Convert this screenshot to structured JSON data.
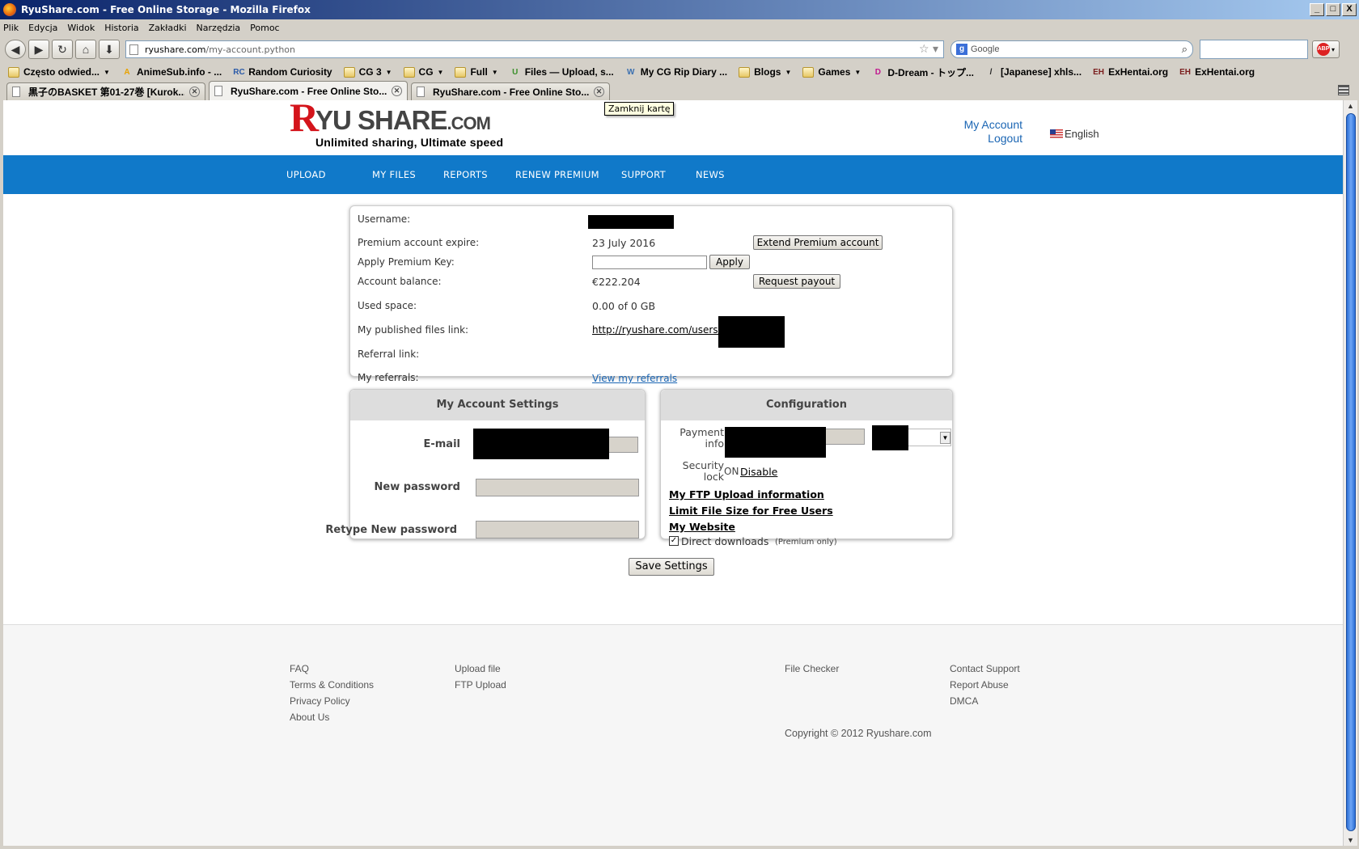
{
  "window": {
    "title": "RyuShare.com - Free Online Storage - Mozilla Firefox",
    "buttons": [
      "_",
      "□",
      "X"
    ]
  },
  "menu": [
    "Plik",
    "Edycja",
    "Widok",
    "Historia",
    "Zakładki",
    "Narzędzia",
    "Pomoc"
  ],
  "urlbar": {
    "host": "ryushare.com",
    "path": "/my-account.python"
  },
  "search": {
    "engine_icon": "g",
    "placeholder": "Google"
  },
  "bookmarks": [
    {
      "label": "Często odwied...",
      "icon": "gear-folder",
      "caret": true
    },
    {
      "label": "AnimeSub.info - ...",
      "icon": "A",
      "caret": false
    },
    {
      "label": "Random Curiosity",
      "icon": "RC",
      "caret": false
    },
    {
      "label": "CG 3",
      "icon": "folder",
      "caret": true
    },
    {
      "label": "CG",
      "icon": "folder",
      "caret": true
    },
    {
      "label": "Full",
      "icon": "folder",
      "caret": true
    },
    {
      "label": "Files — Upload, s...",
      "icon": "U",
      "caret": false
    },
    {
      "label": "My CG Rip Diary ...",
      "icon": "W",
      "caret": false
    },
    {
      "label": "Blogs",
      "icon": "folder",
      "caret": true
    },
    {
      "label": "Games",
      "icon": "folder",
      "caret": true
    },
    {
      "label": "D-Dream - トップ...",
      "icon": "D",
      "caret": false
    },
    {
      "label": "[Japanese] xhls...",
      "icon": "/",
      "caret": false
    },
    {
      "label": "ExHentai.org",
      "icon": "EH",
      "caret": false
    },
    {
      "label": "ExHentai.org",
      "icon": "EH",
      "caret": false
    }
  ],
  "tabs": [
    {
      "label": "黒子のBASKET 第01-27巻 [Kurok..."
    },
    {
      "label": "RyuShare.com - Free Online Sto..."
    },
    {
      "label": "RyuShare.com - Free Online Sto..."
    }
  ],
  "tooltip": "Zamknij kartę",
  "site": {
    "logo": {
      "r": "R",
      "rest": "YU SHARE",
      "com": ".COM",
      "tagline": "Unlimited sharing, Ultimate speed"
    },
    "header": {
      "my_account": "My Account",
      "logout": "Logout",
      "language": "English"
    },
    "nav": [
      "UPLOAD",
      "MY FILES",
      "REPORTS",
      "RENEW PREMIUM",
      "SUPPORT",
      "NEWS"
    ],
    "account": {
      "username_label": "Username:",
      "premium_expire_label": "Premium account expire:",
      "premium_expire_value": "23 July 2016",
      "extend_button": "Extend Premium account",
      "apply_key_label": "Apply Premium Key:",
      "apply_key_value": "",
      "apply_button": "Apply",
      "balance_label": "Account balance:",
      "balance_value": "€222.204",
      "payout_button": "Request payout",
      "used_space_label": "Used space:",
      "used_space_value": "0.00 of 0 GB",
      "published_label": "My published files link:",
      "published_value": "http://ryushare.com/users/",
      "referral_label": "Referral link:",
      "referrals_label": "My referrals:",
      "referrals_link": "View my referrals"
    },
    "settings": {
      "title": "My Account Settings",
      "email_label": "E-mail",
      "new_password_label": "New password",
      "retype_label": "Retype New password"
    },
    "config": {
      "title": "Configuration",
      "payment_label_1": "Payment",
      "payment_label_2": "info",
      "security_label_1": "Security",
      "security_label_2": "lock",
      "security_state": "ON",
      "security_action": "Disable",
      "ftp_link": "My FTP Upload information",
      "limit_link": "Limit File Size for Free Users",
      "website_link": "My Website",
      "direct_label": "Direct downloads",
      "direct_note": "(Premium only)",
      "direct_checked": true
    },
    "save_button": "Save Settings",
    "footer": {
      "col1": [
        "FAQ",
        "Terms & Conditions",
        "Privacy Policy",
        "About Us"
      ],
      "col2": [
        "Upload file",
        "FTP Upload"
      ],
      "col3": [
        "File Checker"
      ],
      "col4": [
        "Contact Support",
        "Report Abuse",
        "DMCA"
      ],
      "copyright": "Copyright © 2012 Ryushare.com"
    }
  }
}
